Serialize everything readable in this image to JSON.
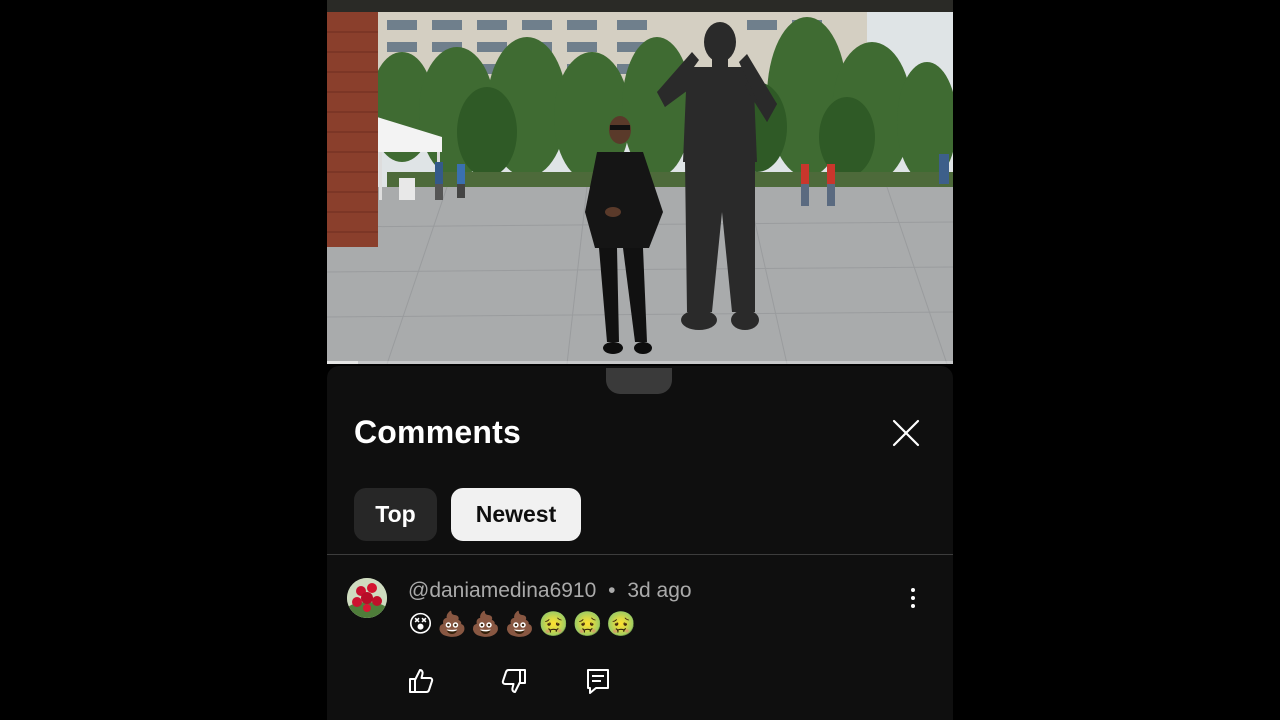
{
  "video": {
    "progress": 0.05
  },
  "comments_panel": {
    "title": "Comments",
    "sort_options": [
      "Top",
      "Newest"
    ],
    "selected_sort": "Newest"
  },
  "comments": [
    {
      "author": "@daniamedina6910",
      "separator": "•",
      "time": "3d ago",
      "text": "😵💩💩💩🤢🤢🤢"
    }
  ],
  "icons": {
    "close": "close-icon",
    "more": "more-vert-icon",
    "like": "thumb-up-icon",
    "dislike": "thumb-down-icon",
    "reply": "reply-comment-icon"
  },
  "colors": {
    "sheet_background": "#0f0f0f",
    "chip_selected": "#f1f1f1",
    "chip_unselected": "#272727",
    "meta_text": "#aaaaaa"
  }
}
